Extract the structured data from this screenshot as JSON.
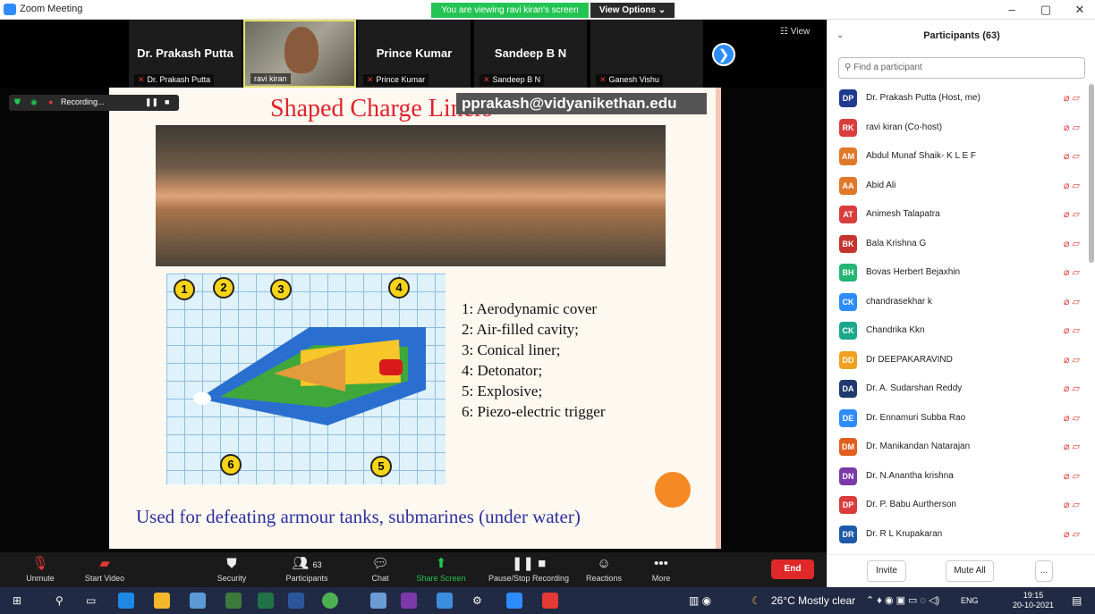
{
  "window": {
    "title": "Zoom Meeting",
    "viewing_banner": "You are viewing ravi kiran's screen",
    "view_options": "View Options ⌄",
    "minimize": "–",
    "maximize": "▢",
    "close": "✕"
  },
  "video_strip": {
    "tiles": [
      {
        "name": "Dr. Prakash Putta",
        "label": "Dr. Prakash Putta"
      },
      {
        "name": "",
        "label": "ravi kiran"
      },
      {
        "name": "Prince Kumar",
        "label": "Prince Kumar"
      },
      {
        "name": "Sandeep B N",
        "label": "Sandeep B N"
      },
      {
        "name": "",
        "label": "Ganesh Vishu"
      }
    ],
    "next_icon": "❯",
    "view_label": "☷ View"
  },
  "share": {
    "recording_label": "Recording...",
    "slide": {
      "title": "Shaped Charge Liners",
      "email": "pprakash@vidyanikethan.edu",
      "legend": [
        "1: Aerodynamic cover",
        "2: Air-filled cavity;",
        "3: Conical liner;",
        "4: Detonator;",
        "5: Explosive;",
        "6: Piezo-electric trigger"
      ],
      "callouts": [
        "1",
        "2",
        "3",
        "4",
        "5",
        "6"
      ],
      "footer": "Used for defeating armour tanks, submarines (under water)"
    }
  },
  "toolbar": {
    "unmute": "Unmute",
    "start_video": "Start Video",
    "security": "Security",
    "participants": "Participants",
    "participants_count": "63",
    "chat": "Chat",
    "share_screen": "Share Screen",
    "pause_recording": "Pause/Stop Recording",
    "reactions": "Reactions",
    "more": "More",
    "end": "End"
  },
  "panel": {
    "title": "Participants (63)",
    "search_placeholder": "Find a participant",
    "participants": [
      {
        "initials": "DP",
        "name": "Dr. Prakash Putta (Host, me)",
        "color": "#1f3a8f"
      },
      {
        "initials": "RK",
        "name": "ravi kiran (Co-host)",
        "color": "#d93d3d"
      },
      {
        "initials": "AM",
        "name": "Abdul Munaf Shaik- K L E F",
        "color": "#e0782a"
      },
      {
        "initials": "AA",
        "name": "Abid Ali",
        "color": "#e0782a"
      },
      {
        "initials": "AT",
        "name": "Animesh Talapatra",
        "color": "#d93d3d"
      },
      {
        "initials": "BK",
        "name": "Bala Krishna G",
        "color": "#c7342f"
      },
      {
        "initials": "BH",
        "name": "Bovas Herbert Bejaxhin",
        "color": "#22b573"
      },
      {
        "initials": "CK",
        "name": "chandrasekhar k",
        "color": "#2d8cff"
      },
      {
        "initials": "CK",
        "name": "Chandrika Kkn",
        "color": "#1aa88a"
      },
      {
        "initials": "DD",
        "name": "Dr DEEPAKARAVIND",
        "color": "#f0a020"
      },
      {
        "initials": "DA",
        "name": "Dr. A. Sudarshan Reddy",
        "color": "#1f3a6f"
      },
      {
        "initials": "DE",
        "name": "Dr. Ennamuri Subba Rao",
        "color": "#2d8cff"
      },
      {
        "initials": "DM",
        "name": "Dr. Manikandan Natarajan",
        "color": "#e06020"
      },
      {
        "initials": "DN",
        "name": "Dr. N.Anantha krishna",
        "color": "#7b3aa8"
      },
      {
        "initials": "DP",
        "name": "Dr. P. Babu Aurtherson",
        "color": "#d93d3d"
      },
      {
        "initials": "DR",
        "name": "Dr. R L Krupakaran",
        "color": "#1f5aa8"
      }
    ],
    "invite": "Invite",
    "mute_all": "Mute All",
    "more": "..."
  },
  "taskbar": {
    "weather": "26°C Mostly clear",
    "lang": "ENG",
    "time": "19:15",
    "date": "20-10-2021"
  }
}
